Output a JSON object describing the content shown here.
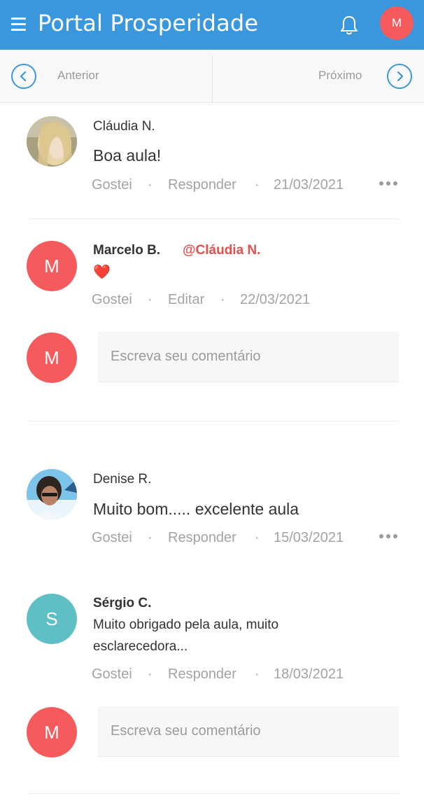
{
  "header": {
    "title": "Portal Prosperidade",
    "user_initial": "M",
    "colors": {
      "bar": "#3b97dc",
      "avatar": "#f55a5d"
    }
  },
  "pager": {
    "prev_label": "Anterior",
    "next_label": "Próximo"
  },
  "actions": {
    "like": "Gostei",
    "reply": "Responder",
    "edit": "Editar",
    "separator": "·"
  },
  "comments": [
    {
      "author": "Cláudia N.",
      "text": "Boa aula!",
      "date": "21/03/2021",
      "avatar": "photo",
      "replies": [
        {
          "author": "Marcelo B.",
          "mention": "@Cláudia N.",
          "text": "❤️",
          "date": "22/03/2021",
          "initial": "M"
        }
      ],
      "reply_box": {
        "initial": "M",
        "placeholder": "Escreva seu comentário"
      }
    },
    {
      "author": "Denise R.",
      "text": "Muito bom..... excelente aula",
      "date": "15/03/2021",
      "avatar": "photo",
      "replies": [
        {
          "author": "Sérgio C.",
          "text_line1": "Muito obrigado pela aula, muito",
          "text_line2": "esclarecedora...",
          "date": "18/03/2021",
          "initial": "S"
        }
      ],
      "reply_box": {
        "initial": "M",
        "placeholder": "Escreva seu comentário"
      }
    }
  ]
}
